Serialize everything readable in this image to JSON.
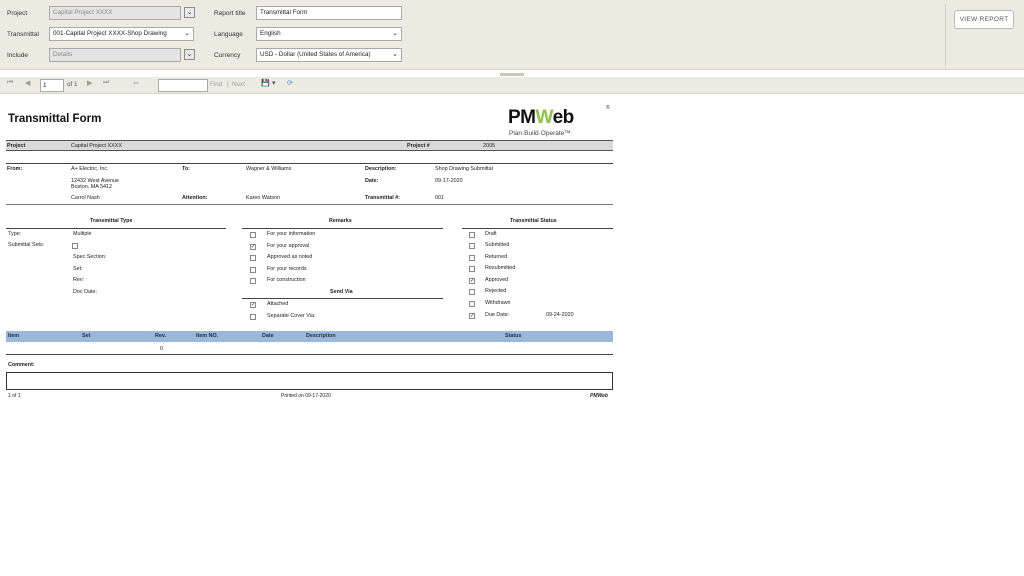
{
  "params": {
    "project_label": "Project",
    "project_value": "Capital Project XXXX",
    "transmittal_label": "Transmittal",
    "transmittal_value": "001-Capital Project XXXX-Shop Drawing",
    "include_label": "Include",
    "include_value": "Details",
    "report_title_label": "Report title",
    "report_title_value": "Transmittal Form",
    "language_label": "Language",
    "language_value": "English",
    "currency_label": "Currency",
    "currency_value": "USD - Dollar (United States of America)",
    "view_report": "VIEW REPORT"
  },
  "toolbar": {
    "page_value": "1",
    "of_pages": "of 1",
    "find_label": "Find",
    "separator": "|",
    "next_label": "Next"
  },
  "report": {
    "title": "Transmittal Form",
    "logo": {
      "text_pm": "PM",
      "text_w": "W",
      "text_eb": "eb",
      "tagline": "Plan·Build·Operate™",
      "reg": "®"
    },
    "project_label": "Project",
    "project_value": "Capital Project XXXX",
    "project_no_label": "Project #",
    "project_no_value": "2005",
    "from_label": "From:",
    "from_name": "A+ Electric, Inc.",
    "from_address1": "12432 West Avenue",
    "from_address2": "Boston, MA 5412",
    "from_contact": "Carrol Nash",
    "to_label": "To:",
    "to_value": "Wagner & Williams",
    "attention_label": "Attention:",
    "attention_value": "Karen Watson",
    "description_label": "Description:",
    "description_value": "Shop Drawing Submittal",
    "date_label": "Date:",
    "date_value": "09-17-2020",
    "transmittal_no_label": "Transmittal #:",
    "transmittal_no_value": "001",
    "type_section": {
      "header": "Transmittal Type",
      "type_label": "Type:",
      "type_value": "Multiple",
      "submittal_sets_label": "Submittal Sets:",
      "spec_section_label": "Spec Section:",
      "set_label": "Set:",
      "rev_label": "Rev:",
      "doc_date_label": "Doc Date:"
    },
    "remarks": {
      "header": "Remarks",
      "items": [
        {
          "label": "For your information",
          "checked": ""
        },
        {
          "label": "For your approval",
          "checked": "✓"
        },
        {
          "label": "Approved as noted",
          "checked": ""
        },
        {
          "label": "For your records",
          "checked": ""
        },
        {
          "label": "For construction",
          "checked": ""
        }
      ],
      "send_via_header": "Send Via",
      "send_via": [
        {
          "label": "Attached",
          "checked": "✓"
        },
        {
          "label": "Separate Cover Via:",
          "checked": ""
        }
      ]
    },
    "status": {
      "header": "Transmittal Status",
      "items": [
        {
          "label": "Draft",
          "checked": ""
        },
        {
          "label": "Submitted",
          "checked": ""
        },
        {
          "label": "Returned",
          "checked": ""
        },
        {
          "label": "Resubmitted",
          "checked": ""
        },
        {
          "label": "Approved",
          "checked": "✓"
        },
        {
          "label": "Rejected",
          "checked": ""
        },
        {
          "label": "Withdrawn",
          "checked": ""
        },
        {
          "label": "Due Date:",
          "checked": "✓"
        }
      ],
      "due_date_value": "09-24-2020"
    },
    "table": {
      "headers": [
        "Item",
        "Set",
        "Rev.",
        "Item NO.",
        "Date",
        "Description",
        "Status"
      ],
      "rows": [
        {
          "item": "",
          "set": "",
          "rev": "0",
          "item_no": "",
          "date": "",
          "description": "",
          "status": ""
        }
      ]
    },
    "comment_label": "Comment:",
    "footer": {
      "page": "1 of 1",
      "printed": "Printed on 09-17-2020",
      "brand": "PMWeb"
    }
  }
}
